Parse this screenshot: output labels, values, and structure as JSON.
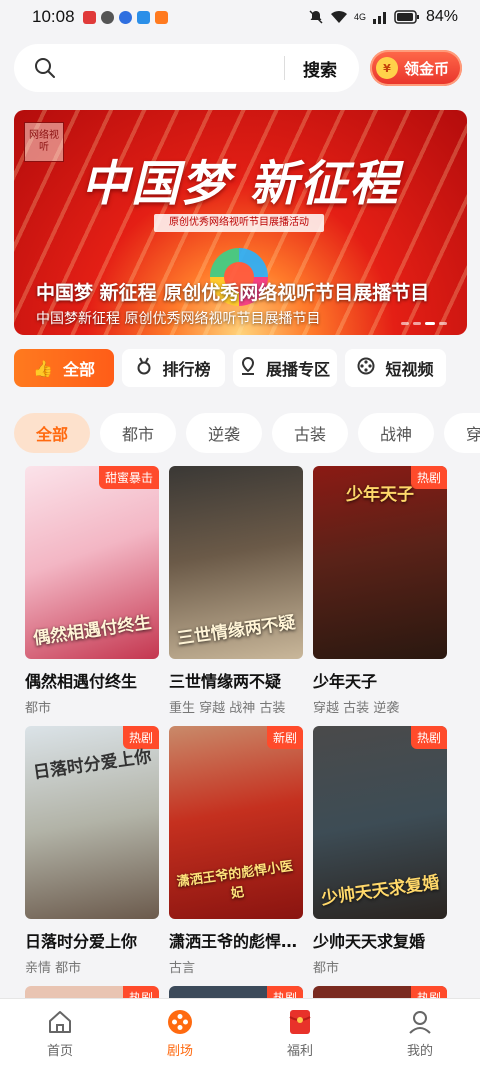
{
  "status_bar": {
    "time": "10:08",
    "battery": "84%",
    "signal": "4G"
  },
  "search": {
    "placeholder": "",
    "button_label": "搜索"
  },
  "coin_button": {
    "label": "领金币"
  },
  "banner": {
    "logo_text": "网络视听",
    "headline": "中国梦 新征程",
    "ribbon": "原创优秀网络视听节目展播活动",
    "caption_main": "中国梦 新征程 原创优秀网络视听节目展播节目",
    "caption_sub": "中国梦新征程 原创优秀网络视听节目展播节目",
    "slide_count": 4,
    "active_slide": 3
  },
  "tabs": [
    {
      "label": "全部",
      "icon": "thumbs-up-icon",
      "active": true
    },
    {
      "label": "排行榜",
      "icon": "medal-icon",
      "active": false
    },
    {
      "label": "展播专区",
      "icon": "location-pin-icon",
      "active": false
    },
    {
      "label": "短视频",
      "icon": "film-reel-icon",
      "active": false
    }
  ],
  "genres": [
    "全部",
    "都市",
    "逆袭",
    "古装",
    "战神",
    "穿越"
  ],
  "active_genre": "全部",
  "dramas": [
    {
      "title": "偶然相遇付终生",
      "tags": "都市",
      "badge": "甜蜜暴击",
      "poster_text": "偶然相遇付终生"
    },
    {
      "title": "三世情缘两不疑",
      "tags": "重生 穿越 战神 古装",
      "badge": "",
      "poster_text": "三世情缘两不疑"
    },
    {
      "title": "少年天子",
      "tags": "穿越 古装 逆袭",
      "badge": "热剧",
      "poster_text": "少年天子"
    },
    {
      "title": "日落时分爱上你",
      "tags": "亲情 都市",
      "badge": "热剧",
      "poster_text": "日落时分爱上你"
    },
    {
      "title": "潇洒王爷的彪悍小医妃",
      "tags": "古言",
      "badge": "新剧",
      "poster_text": "潇洒王爷的彪悍小医妃"
    },
    {
      "title": "少帅天天求复婚",
      "tags": "都市",
      "badge": "热剧",
      "poster_text": "少帅天天求复婚"
    }
  ],
  "peek_badges": [
    "热剧",
    "热剧",
    "热剧"
  ],
  "bottom_nav": [
    {
      "label": "首页",
      "icon": "home-icon",
      "active": false
    },
    {
      "label": "剧场",
      "icon": "film-reel-icon",
      "active": true
    },
    {
      "label": "福利",
      "icon": "red-envelope-icon",
      "active": false
    },
    {
      "label": "我的",
      "icon": "profile-icon",
      "active": false
    }
  ],
  "colors": {
    "accent": "#ff6a10",
    "badge": "#ff4b2b",
    "coin_button": "#e8322a"
  }
}
